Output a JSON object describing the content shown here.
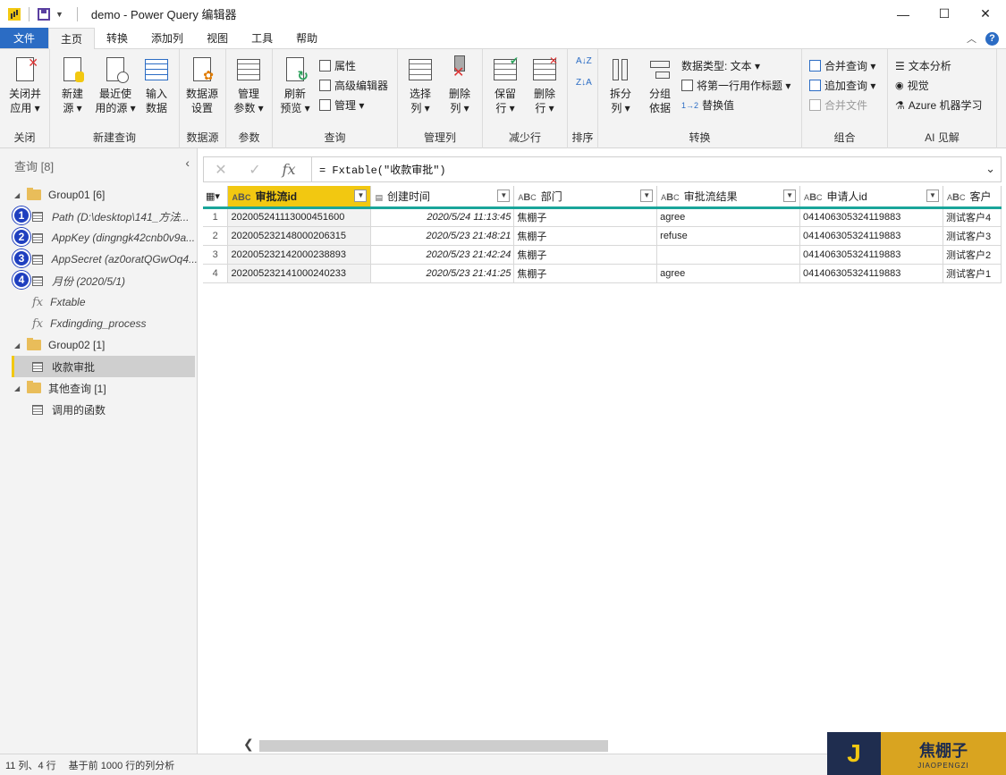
{
  "window": {
    "title": "demo - Power Query 编辑器",
    "min": "—",
    "max": "☐",
    "close": "✕"
  },
  "tabs": [
    "文件",
    "主页",
    "转换",
    "添加列",
    "视图",
    "工具",
    "帮助"
  ],
  "ribbon": {
    "close": {
      "btn1": "关闭并",
      "btn1b": "应用 ▾",
      "label": "关闭"
    },
    "newquery": {
      "new": "新建",
      "newb": "源 ▾",
      "recent": "最近使",
      "recentb": "用的源 ▾",
      "enter": "输入",
      "enterb": "数据",
      "label": "新建查询"
    },
    "datasource": {
      "btn": "数据源",
      "btnb": "设置",
      "label": "数据源"
    },
    "params": {
      "btn": "管理",
      "btnb": "参数 ▾",
      "label": "参数"
    },
    "query": {
      "refresh": "刷新",
      "refreshb": "预览 ▾",
      "props": "属性",
      "adv": "高级编辑器",
      "manage": "管理 ▾",
      "label": "查询"
    },
    "cols": {
      "choose": "选择",
      "chooseb": "列 ▾",
      "remove": "删除",
      "removeb": "列 ▾",
      "label": "管理列"
    },
    "rows": {
      "keep": "保留",
      "keepb": "行 ▾",
      "remove": "删除",
      "removeb": "行 ▾",
      "label": "减少行"
    },
    "sort": {
      "label": "排序"
    },
    "transform": {
      "split": "拆分",
      "splitb": "列 ▾",
      "group": "分组",
      "groupb": "依据",
      "dtype": "数据类型: 文本 ▾",
      "firstrow": "将第一行用作标题 ▾",
      "replace": "替换值",
      "label": "转换"
    },
    "combine": {
      "merge": "合并查询 ▾",
      "append": "追加查询 ▾",
      "files": "合并文件",
      "label": "组合"
    },
    "ai": {
      "text": "文本分析",
      "vision": "视觉",
      "azure": "Azure 机器学习",
      "label": "AI 见解"
    }
  },
  "left": {
    "header": "查询 [8]",
    "group1": "Group01 [6]",
    "items1": [
      "Path (D:\\desktop\\141_方法...",
      "AppKey (dingngk42cnb0v9a...",
      "AppSecret (az0oratQGwOq4...",
      "月份 (2020/5/1)"
    ],
    "fx1": "Fxtable",
    "fx2": "Fxdingding_process",
    "group2": "Group02 [1]",
    "sel": "收款审批",
    "group3": "其他查询 [1]",
    "other": "调用的函数",
    "badges": [
      "1",
      "2",
      "3",
      "4"
    ]
  },
  "formula": {
    "text": "= Fxtable(\"收款审批\")"
  },
  "grid": {
    "headers": [
      "审批流id",
      "创建时间",
      "部门",
      "审批流结果",
      "申请人id",
      "客户"
    ],
    "rows": [
      [
        "1",
        "202005241113000451600",
        "2020/5/24 11:13:45",
        "焦棚子",
        "agree",
        "041406305324119883",
        "测试客户4"
      ],
      [
        "2",
        "202005232148000206315",
        "2020/5/23 21:48:21",
        "焦棚子",
        "refuse",
        "041406305324119883",
        "测试客户3"
      ],
      [
        "3",
        "202005232142000238893",
        "2020/5/23 21:42:24",
        "焦棚子",
        "",
        "041406305324119883",
        "测试客户2"
      ],
      [
        "4",
        "202005232141000240233",
        "2020/5/23 21:41:25",
        "焦棚子",
        "agree",
        "041406305324119883",
        "测试客户1"
      ]
    ]
  },
  "status": {
    "cols": "11 列、4 行",
    "profile": "基于前 1000 行的列分析"
  },
  "watermark": {
    "j": "J",
    "name": "焦棚子",
    "pinyin": "JIAOPENGZI"
  }
}
